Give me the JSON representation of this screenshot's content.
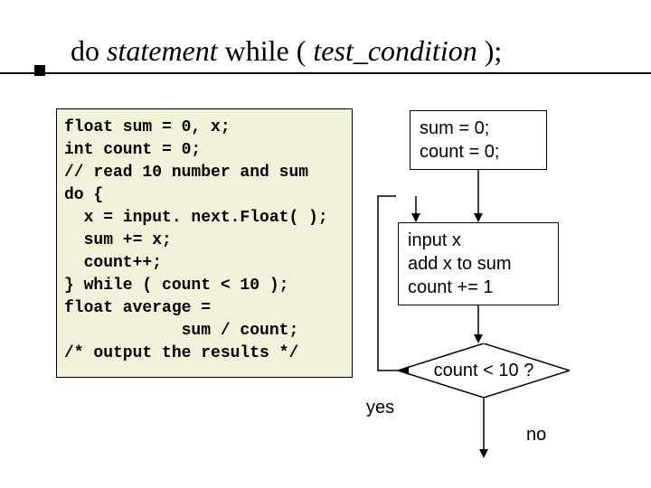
{
  "title": {
    "t1": "do ",
    "t2": "statement",
    "t3": " while ( ",
    "t4": "test_condition",
    "t5": " );"
  },
  "code": "float sum = 0, x;\nint count = 0;\n// read 10 number and sum\ndo {\n  x = input. next.Float( );\n  sum += x;\n  count++;\n} while ( count < 10 );\nfloat average =\n            sum / count;\n/* output the results */",
  "flow": {
    "init": "sum = 0;\ncount = 0;",
    "body": "input x\nadd x to sum\ncount += 1",
    "cond": "count < 10 ?",
    "yes": "yes",
    "no": "no"
  }
}
